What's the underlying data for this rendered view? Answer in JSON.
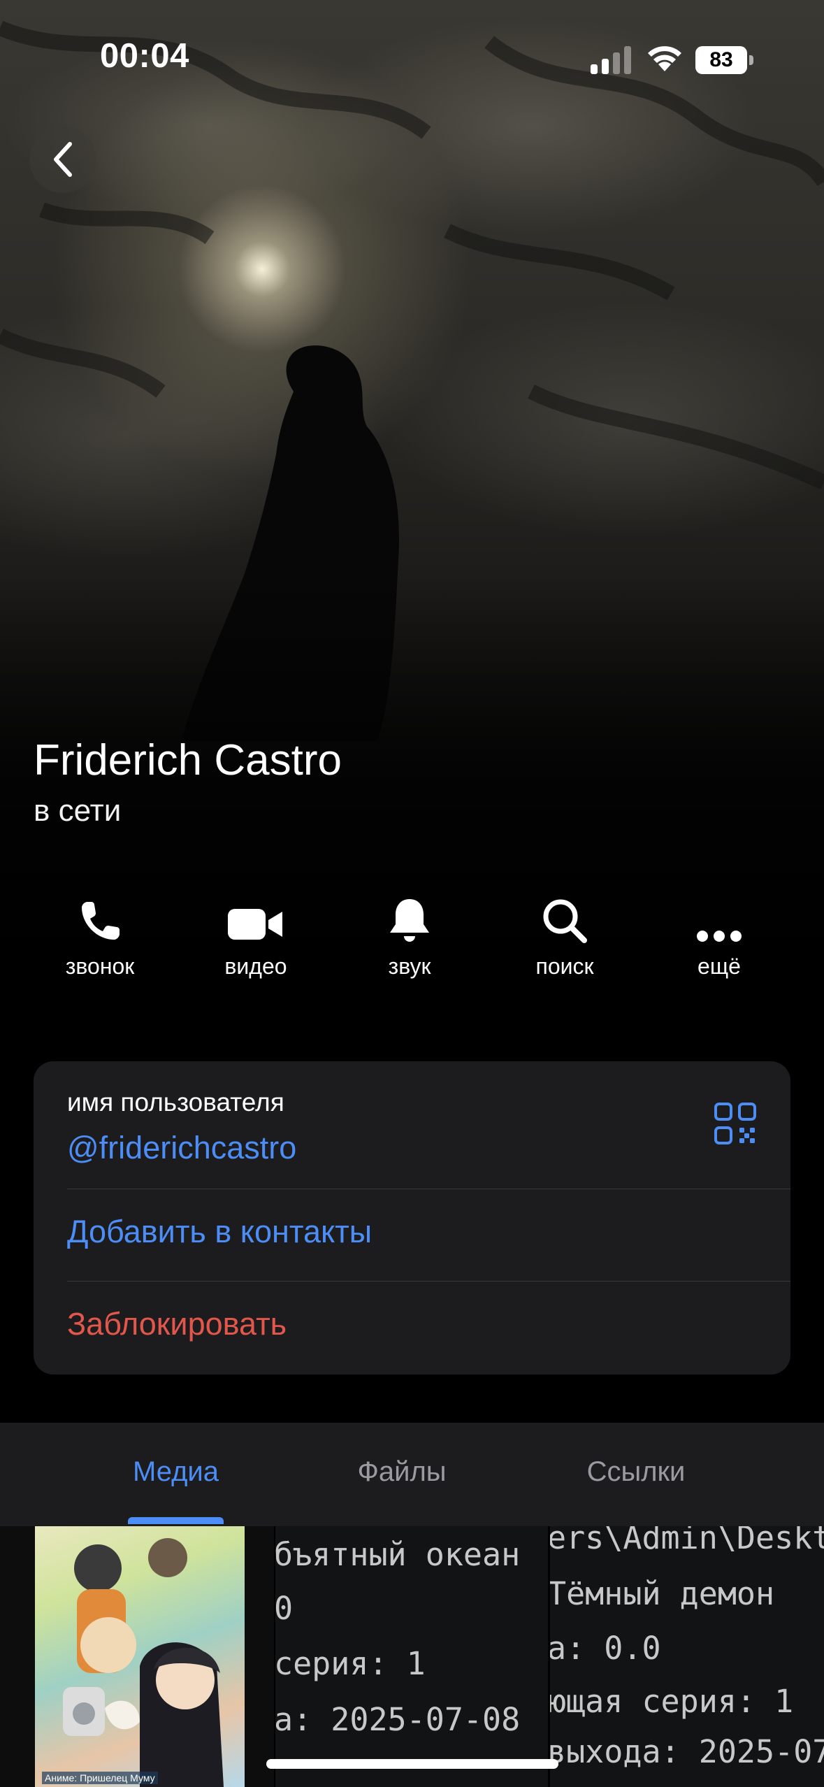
{
  "status_bar": {
    "time": "00:04",
    "battery": "83"
  },
  "profile": {
    "name": "Friderich Castro",
    "status": "в сети"
  },
  "actions": [
    {
      "icon": "phone-icon",
      "label": "звонок"
    },
    {
      "icon": "video-camera-icon",
      "label": "видео"
    },
    {
      "icon": "bell-icon",
      "label": "звук"
    },
    {
      "icon": "search-icon",
      "label": "поиск"
    },
    {
      "icon": "more-dots-icon",
      "label": "ещё"
    }
  ],
  "info": {
    "username_caption": "имя пользователя",
    "username": "@friderichcastro",
    "add_contact": "Добавить в контакты",
    "block": "Заблокировать"
  },
  "tabs": {
    "media": "Медиа",
    "files": "Файлы",
    "links": "Ссылки",
    "active": "media"
  },
  "media_tiles": {
    "poster_caption": "Аниме: Пришелец Муму",
    "tile2_lines": [
      "бъятный океан",
      "0",
      "серия: 1",
      "а: 2025-07-08"
    ],
    "tile3_lines": [
      "ers\\Admin\\Deskt",
      " Тёмный демон",
      "а: 0.0",
      "ющая серия: 1",
      "выхода: 2025-07"
    ]
  },
  "colors": {
    "accent": "#4c8df6",
    "danger": "#e2574c",
    "card_bg": "#1c1c1e"
  }
}
